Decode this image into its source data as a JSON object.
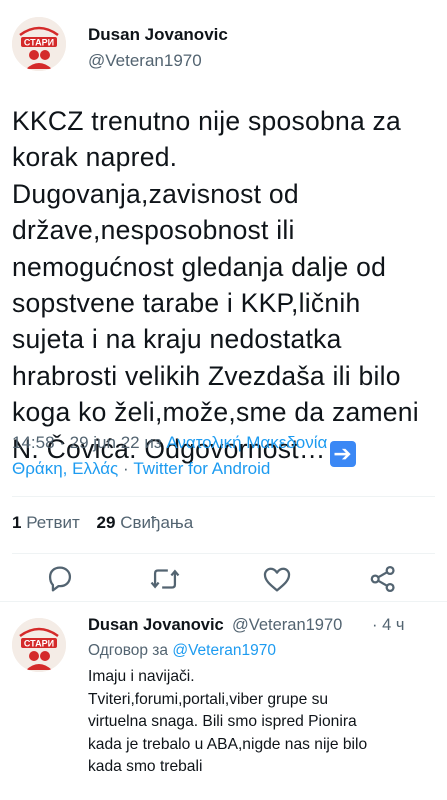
{
  "main_tweet": {
    "author_name": "Dusan Jovanovic",
    "author_handle": "@Veteran1970",
    "avatar_text": [
      "СТАРИ"
    ],
    "text_lines": [
      "KKCZ trenutno nije sposobna za",
      "korak napred.",
      "Dugovanja,zavisnost od",
      "države,nesposobnost ili",
      "nemogućnost gledanja dalje od",
      "sopstvene tarabe i KKP,ličnih",
      "sujeta i na kraju nedostatka",
      "hrabrosti velikih Zvezdaša ili bilo",
      "koga ko želi,može,sme da zameni",
      "N. Čovića. Odgovornost…"
    ],
    "arrow_emoji": "➔",
    "meta_line1_prefix": "14:58 · 29 jun 22 из ",
    "meta_line1_location": "Ανατολική Μακεδονία",
    "meta_line2_location": "Θράκη, Ελλάς",
    "meta_line2_sep": " · ",
    "meta_source": "Twitter for Android",
    "retweet_count": "1",
    "retweet_label": "Ретвит",
    "like_count": "29",
    "like_label": "Свиђања",
    "action_icons": [
      "reply-icon",
      "retweet-icon",
      "like-icon",
      "share-icon"
    ]
  },
  "reply_tweet": {
    "author_name": "Dusan Jovanovic",
    "author_handle": "@Veteran1970",
    "time": "· 4 ч",
    "reply_to_label": "Одговор за ",
    "reply_to_handle": "@Veteran1970",
    "text_lines": [
      "Imaju i navijači.",
      "Tviteri,forumi,portali,viber grupe su",
      "virtuelna snaga. Bili smo ispred Pionira",
      "kada je trebalo u ABA,nigde nas nije bilo",
      "kada smo trebali"
    ]
  },
  "colors": {
    "link": "#1d9bf0",
    "secondary": "#536471",
    "text": "#0f1419",
    "divider": "#eff3f4",
    "avatar_red": "#d42a2a"
  }
}
